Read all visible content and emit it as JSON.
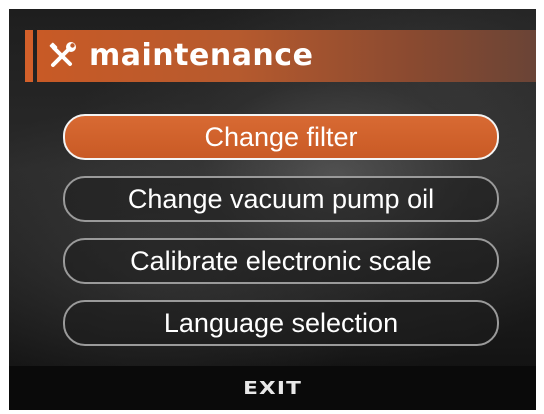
{
  "header": {
    "icon": "wrench-screwdriver-icon",
    "title": "maintenance"
  },
  "menu": {
    "selected_index": 0,
    "items": [
      {
        "label": "Change filter"
      },
      {
        "label": "Change vacuum pump oil"
      },
      {
        "label": "Calibrate electronic scale"
      },
      {
        "label": "Language selection"
      }
    ]
  },
  "footer": {
    "exit_label": "EXIT"
  },
  "colors": {
    "accent": "#d3602a",
    "selected_fill": "#c95a25",
    "item_border": "#9a9a9a",
    "text": "#ffffff"
  }
}
